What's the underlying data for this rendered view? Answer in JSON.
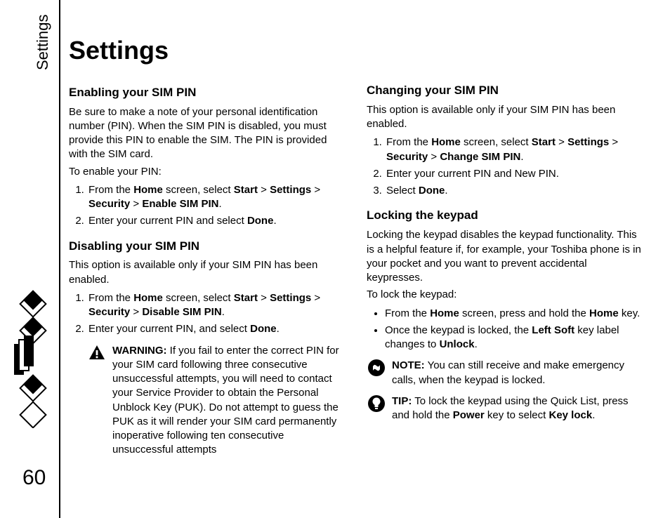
{
  "sideLabel": "Settings",
  "pageNumber": "60",
  "title": "Settings",
  "col1": {
    "h_enable": "Enabling your SIM PIN",
    "enable_p1": "Be sure to make a note of your personal identification number (PIN). When the SIM PIN is disabled, you must provide this PIN to enable the SIM. The PIN is provided with the SIM card.",
    "enable_p2": "To enable your PIN:",
    "enable_s1_a": "From the ",
    "enable_s1_b": "Home",
    "enable_s1_c": " screen, select ",
    "enable_s1_d": "Start",
    "enable_s1_e": " > ",
    "enable_s1_f": "Settings",
    "enable_s1_g": " > ",
    "enable_s1_h": "Security",
    "enable_s1_i": " > ",
    "enable_s1_j": "Enable SIM PIN",
    "enable_s1_k": ".",
    "enable_s2_a": "Enter your current PIN and select ",
    "enable_s2_b": "Done",
    "enable_s2_c": ".",
    "h_disable": "Disabling your SIM PIN",
    "disable_p1": "This option is available only if your SIM PIN has been enabled.",
    "disable_s1_a": "From the ",
    "disable_s1_b": "Home",
    "disable_s1_c": " screen, select ",
    "disable_s1_d": "Start",
    "disable_s1_e": " > ",
    "disable_s1_f": "Settings",
    "disable_s1_g": " > ",
    "disable_s1_h": "Security",
    "disable_s1_i": " > ",
    "disable_s1_j": "Disable SIM PIN",
    "disable_s1_k": ".",
    "disable_s2_a": "Enter your current PIN, and select ",
    "disable_s2_b": "Done",
    "disable_s2_c": ".",
    "warn_label": "WARNING:",
    "warn_text": " If you fail to enter the correct PIN for your SIM card following three consecutive unsuccessful attempts, you will need to contact your Service Provider to obtain the Personal Unblock Key (PUK). Do not attempt to guess the PUK as it will render your SIM card permanently inoperative following ten consecutive unsuccessful attempts"
  },
  "col2": {
    "h_change": "Changing your SIM PIN",
    "change_p1": "This option is available only if your SIM PIN has been enabled.",
    "change_s1_a": "From the ",
    "change_s1_b": "Home",
    "change_s1_c": " screen, select ",
    "change_s1_d": "Start",
    "change_s1_e": " > ",
    "change_s1_f": "Settings",
    "change_s1_g": " > ",
    "change_s1_h": "Security",
    "change_s1_i": " > ",
    "change_s1_j": "Change SIM PIN",
    "change_s1_k": ".",
    "change_s2": "Enter your current PIN and New PIN.",
    "change_s3_a": "Select ",
    "change_s3_b": "Done",
    "change_s3_c": ".",
    "h_lock": "Locking the keypad",
    "lock_p1": "Locking the keypad disables the keypad functionality. This is a helpful feature if, for example, your Toshiba phone is in your pocket and you want to prevent accidental keypresses.",
    "lock_p2": "To lock the keypad:",
    "lock_b1_a": "From the ",
    "lock_b1_b": "Home",
    "lock_b1_c": " screen, press and hold the ",
    "lock_b1_d": "Home",
    "lock_b1_e": " key.",
    "lock_b2_a": "Once the keypad is locked, the ",
    "lock_b2_b": "Left Soft",
    "lock_b2_c": " key label changes to ",
    "lock_b2_d": "Unlock",
    "lock_b2_e": ".",
    "note_label": "NOTE:",
    "note_text": " You can still receive and make emergency calls, when the keypad is locked.",
    "tip_label": "TIP:",
    "tip_a": " To lock the keypad using the Quick List, press and hold the ",
    "tip_b": "Power",
    "tip_c": " key to select ",
    "tip_d": "Key lock",
    "tip_e": "."
  }
}
